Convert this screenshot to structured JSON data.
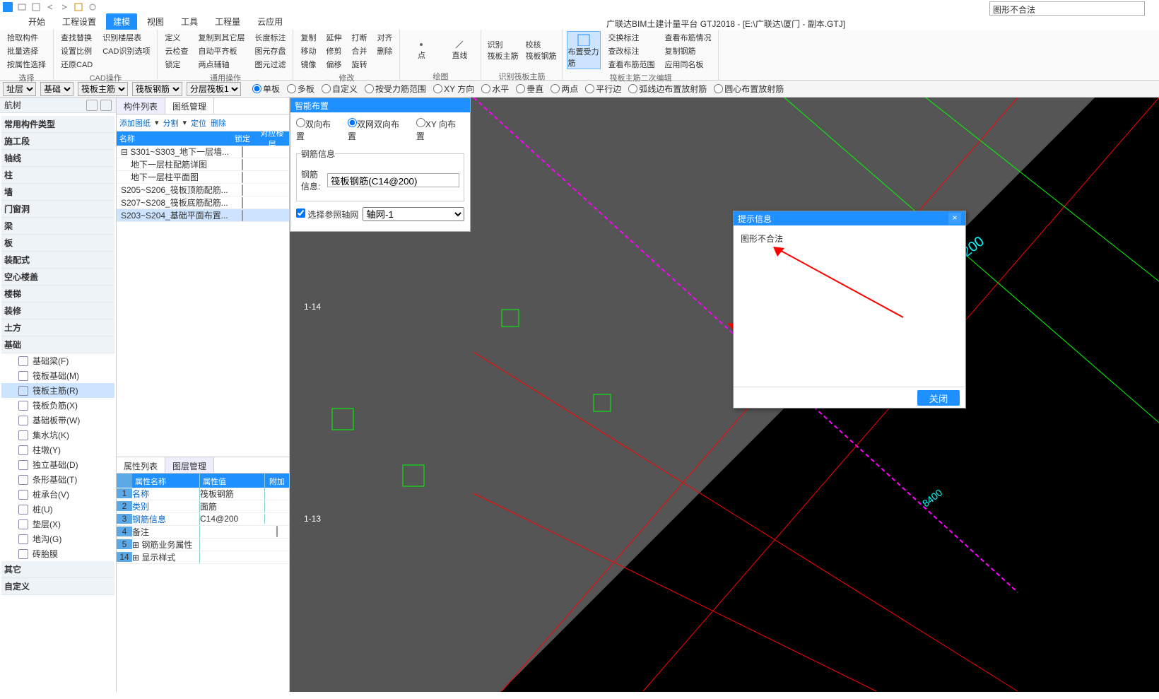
{
  "app": {
    "title": "广联达BIM土建计量平台 GTJ2018 - [E:\\广联达\\厦门 - 副本.GTJ]",
    "side_field_value": "图形不合法"
  },
  "tabs": [
    "开始",
    "工程设置",
    "建模",
    "视图",
    "工具",
    "工程量",
    "云应用"
  ],
  "active_tab_index": 2,
  "ribbon": {
    "group_select": {
      "label": "选择",
      "items": [
        "拾取构件",
        "批量选择",
        "按属性选择"
      ]
    },
    "group_cad": {
      "label": "CAD操作",
      "col1": [
        "查找替换",
        "设置比例",
        "还原CAD"
      ],
      "col2": [
        "识别楼层表",
        "CAD识别选项"
      ],
      "col3": [
        "定义",
        "云检查",
        "锁定"
      ],
      "col4": [
        "复制到其它层",
        "自动平齐板",
        "两点辅轴"
      ],
      "col5": [
        "长度标注",
        "图元存盘",
        "图元过滤"
      ]
    },
    "group_general": {
      "label": "通用操作"
    },
    "group_modify": {
      "label": "修改",
      "col1": [
        "复制",
        "移动",
        "镜像"
      ],
      "col2": [
        "延伸",
        "修剪",
        "偏移"
      ],
      "col3": [
        "打断",
        "合并",
        "旋转"
      ],
      "col4": [
        "对齐",
        "删除"
      ]
    },
    "group_draw": {
      "label": "绘图",
      "items": [
        "点",
        "直线"
      ]
    },
    "group_recognize": {
      "label": "识别筏板主筋",
      "items": [
        "识别\n筏板主筋",
        "校核\n筏板钢筋"
      ]
    },
    "group_edit": {
      "label": "筏板主筋二次编辑",
      "big": "布置受力筋",
      "col1": [
        "交换标注",
        "查改标注",
        "查看布筋范围"
      ],
      "col2": [
        "查看布筋情况",
        "复制钢筋",
        "应用同名板"
      ]
    }
  },
  "typebar": {
    "selects": [
      "址层",
      "基础",
      "筏板主筋",
      "筏板钢筋",
      "分层筏板1"
    ],
    "radios": [
      "单板",
      "多板",
      "自定义",
      "按受力筋范围",
      "XY 方向",
      "水平",
      "垂直",
      "两点",
      "平行边",
      "弧线边布置放射筋",
      "圆心布置放射筋"
    ],
    "radio_checked": 0
  },
  "leftnav": {
    "title": "航树",
    "categories": [
      {
        "name": "常用构件类型",
        "items": []
      },
      {
        "name": "施工段",
        "items": []
      },
      {
        "name": "轴线",
        "items": []
      },
      {
        "name": "柱",
        "items": []
      },
      {
        "name": "墙",
        "items": []
      },
      {
        "name": "门窗洞",
        "items": []
      },
      {
        "name": "梁",
        "items": []
      },
      {
        "name": "板",
        "items": []
      },
      {
        "name": "装配式",
        "items": []
      },
      {
        "name": "空心楼盖",
        "items": []
      },
      {
        "name": "楼梯",
        "items": []
      },
      {
        "name": "装修",
        "items": []
      },
      {
        "name": "土方",
        "items": []
      },
      {
        "name": "基础",
        "items": [
          "基础梁(F)",
          "筏板基础(M)",
          "筏板主筋(R)",
          "筏板负筋(X)",
          "基础板带(W)",
          "集水坑(K)",
          "柱墩(Y)",
          "独立基础(D)",
          "条形基础(T)",
          "桩承台(V)",
          "桩(U)",
          "垫层(X)",
          "地沟(G)",
          "砖胎膜"
        ]
      },
      {
        "name": "其它",
        "items": []
      },
      {
        "name": "自定义",
        "items": []
      }
    ],
    "selected": "筏板主筋(R)"
  },
  "complist": {
    "tabs": [
      "构件列表",
      "图纸管理"
    ],
    "active": 1,
    "toolbar": [
      "添加图纸",
      "分割",
      "定位",
      "删除"
    ],
    "columns": [
      "名称",
      "锁定",
      "对应楼层"
    ],
    "rows": [
      {
        "name": "S301~S303_地下一层墙...",
        "indent": 0,
        "expand": true
      },
      {
        "name": "地下一层柱配筋详图",
        "indent": 1
      },
      {
        "name": "地下一层柱平面图",
        "indent": 1
      },
      {
        "name": "S205~S206_筏板顶筋配筋...",
        "indent": 0
      },
      {
        "name": "S207~S208_筏板底筋配筋...",
        "indent": 0,
        "highlight": true
      },
      {
        "name": "S203~S204_基础平面布置...",
        "indent": 0,
        "selected": true
      }
    ]
  },
  "proppanel": {
    "tabs": [
      "属性列表",
      "图层管理"
    ],
    "active": 0,
    "columns": [
      "",
      "属性名称",
      "属性值",
      "附加"
    ],
    "rows": [
      {
        "n": "1",
        "name": "名称",
        "value": "筏板钢筋",
        "blue": true
      },
      {
        "n": "2",
        "name": "类别",
        "value": "面筋",
        "blue": true,
        "chk": true
      },
      {
        "n": "3",
        "name": "钢筋信息",
        "value": "C14@200",
        "blue": true,
        "chk": true
      },
      {
        "n": "4",
        "name": "备注",
        "value": "",
        "chk": false
      },
      {
        "n": "5",
        "name": "钢筋业务属性",
        "value": "",
        "expand": true
      },
      {
        "n": "14",
        "name": "显示样式",
        "value": "",
        "expand": true
      }
    ]
  },
  "smartpanel": {
    "title": "智能布置",
    "radios": [
      "双向布置",
      "双网双向布置",
      "XY 向布置"
    ],
    "radio_checked": 1,
    "fieldset": "钢筋信息",
    "field_label": "钢筋信息:",
    "field_value": "筏板钢筋(C14@200)",
    "check_label": "选择参照轴网",
    "select_value": "轴网-1"
  },
  "dialog": {
    "title": "提示信息",
    "message": "图形不合法",
    "close_btn": "关闭"
  }
}
